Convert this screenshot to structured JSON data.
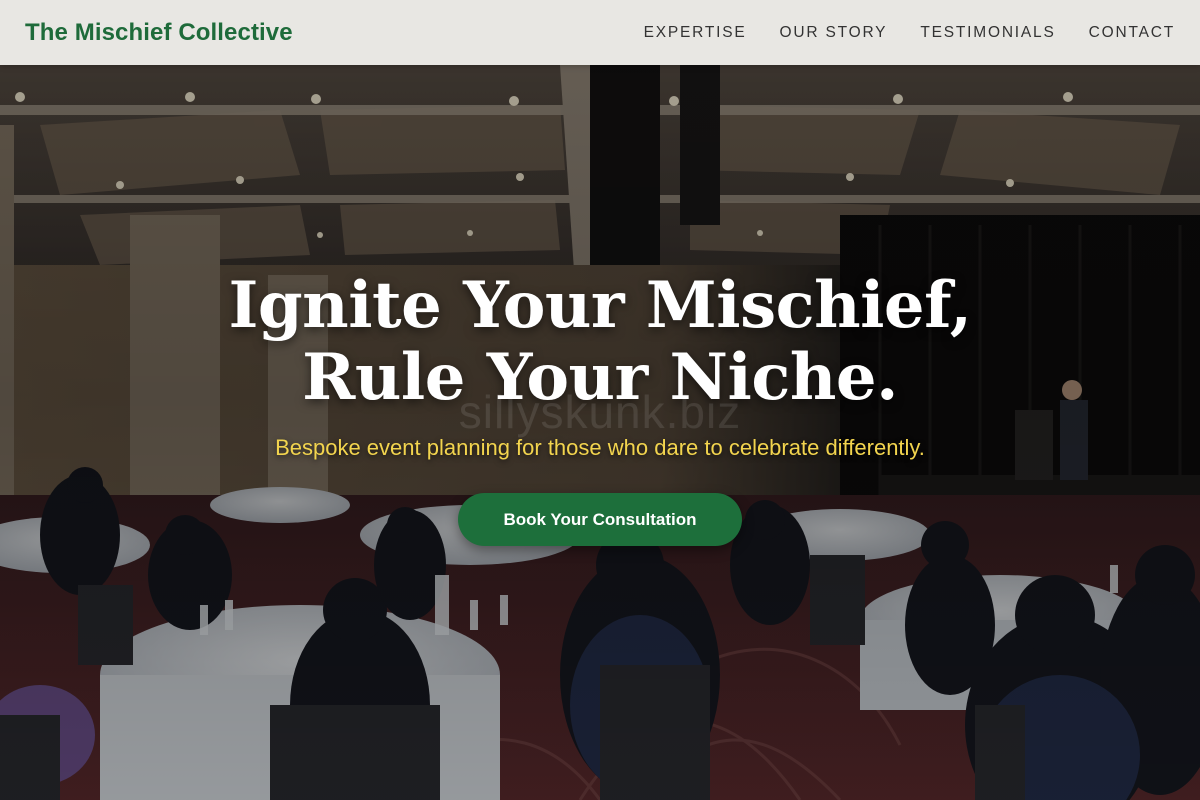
{
  "header": {
    "brand": "The Mischief Collective",
    "nav": [
      {
        "label": "EXPERTISE"
      },
      {
        "label": "OUR STORY"
      },
      {
        "label": "TESTIMONIALS"
      },
      {
        "label": "CONTACT"
      }
    ]
  },
  "hero": {
    "title": "Ignite Your Mischief, Rule Your Niche.",
    "subtitle": "Bespoke event planning for those who dare to celebrate differently.",
    "cta_label": "Book Your Consultation",
    "watermark": "sillyskunk.biz",
    "background_image": "banquet-hall-photo"
  },
  "colors": {
    "brand_green": "#1e6b3a",
    "button_green": "#1d6f3b",
    "subtitle_gold": "#f2d44e",
    "header_bg": "#f0efec",
    "nav_text": "#333333"
  }
}
